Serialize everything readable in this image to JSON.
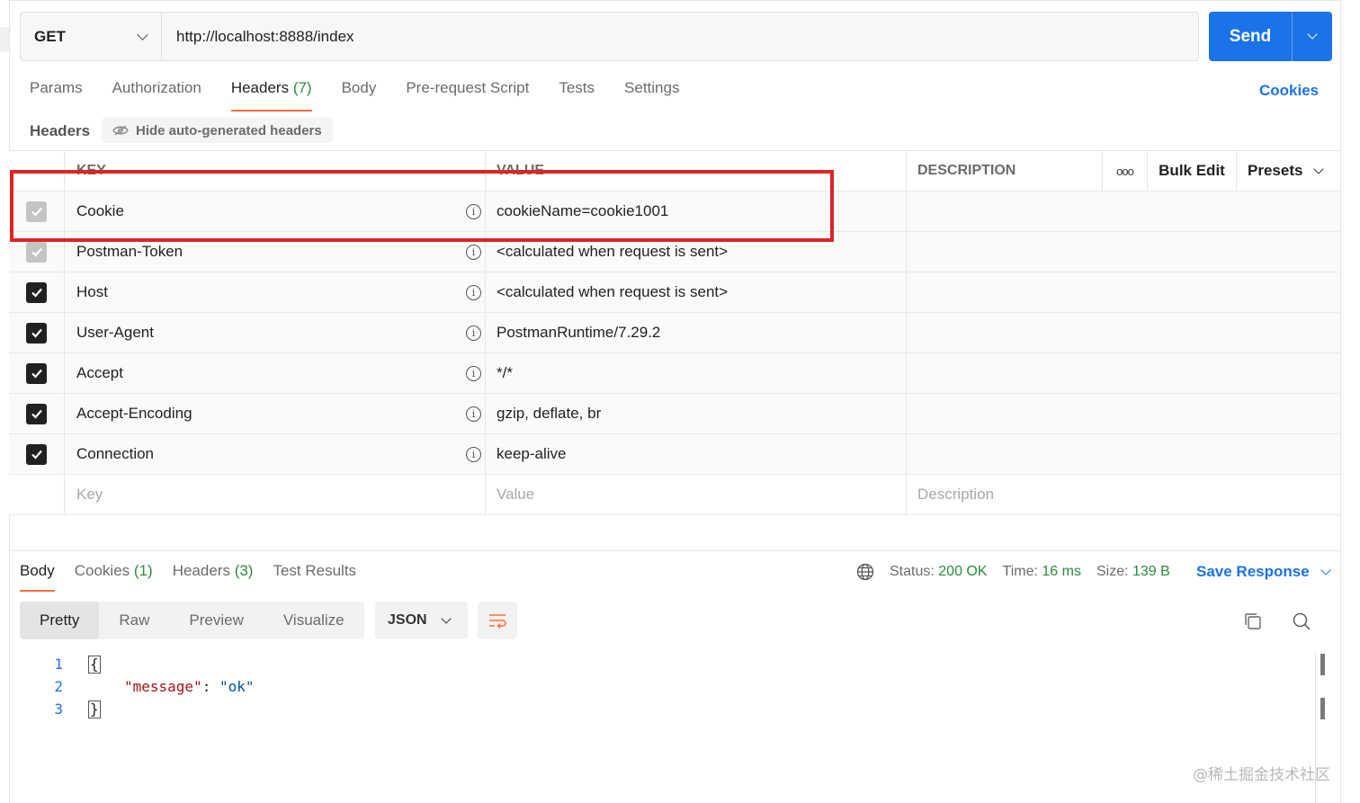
{
  "request": {
    "method": "GET",
    "url": "http://localhost:8888/index",
    "send_label": "Send"
  },
  "req_tabs": [
    {
      "label": "Params",
      "count": ""
    },
    {
      "label": "Authorization",
      "count": ""
    },
    {
      "label": "Headers",
      "count": "(7)"
    },
    {
      "label": "Body",
      "count": ""
    },
    {
      "label": "Pre-request Script",
      "count": ""
    },
    {
      "label": "Tests",
      "count": ""
    },
    {
      "label": "Settings",
      "count": ""
    }
  ],
  "cookies_link": "Cookies",
  "headers_section": {
    "title": "Headers",
    "hide_auto_label": "Hide auto-generated headers"
  },
  "table": {
    "columns": {
      "key": "KEY",
      "value": "VALUE",
      "description": "DESCRIPTION"
    },
    "bulk_edit": "Bulk Edit",
    "presets": "Presets",
    "more": "ooo",
    "rows": [
      {
        "key": "Cookie",
        "value": "cookieName=cookie1001",
        "checked": "dim"
      },
      {
        "key": "Postman-Token",
        "value": "<calculated when request is sent>",
        "checked": "dim"
      },
      {
        "key": "Host",
        "value": "<calculated when request is sent>",
        "checked": "on"
      },
      {
        "key": "User-Agent",
        "value": "PostmanRuntime/7.29.2",
        "checked": "on"
      },
      {
        "key": "Accept",
        "value": "*/*",
        "checked": "on"
      },
      {
        "key": "Accept-Encoding",
        "value": "gzip, deflate, br",
        "checked": "on"
      },
      {
        "key": "Connection",
        "value": "keep-alive",
        "checked": "on"
      }
    ],
    "placeholders": {
      "key": "Key",
      "value": "Value",
      "description": "Description"
    }
  },
  "response": {
    "tabs": [
      {
        "label": "Body",
        "count": ""
      },
      {
        "label": "Cookies",
        "count": "(1)"
      },
      {
        "label": "Headers",
        "count": "(3)"
      },
      {
        "label": "Test Results",
        "count": ""
      }
    ],
    "status_label": "Status:",
    "status_value": "200 OK",
    "time_label": "Time:",
    "time_value": "16 ms",
    "size_label": "Size:",
    "size_value": "139 B",
    "save_label": "Save Response",
    "views": [
      "Pretty",
      "Raw",
      "Preview",
      "Visualize"
    ],
    "format": "JSON",
    "code": {
      "line_numbers": [
        "1",
        "2",
        "3"
      ],
      "open_brace": "{",
      "key": "\"message\"",
      "colon": ": ",
      "value": "\"ok\"",
      "close_brace": "}"
    }
  },
  "watermark": "@稀土掘金技术社区",
  "colors": {
    "accent_blue": "#1a73e8",
    "active_tab_underline": "#ff6c37",
    "highlight_box": "#e02323",
    "success_green": "#2a8a3e"
  }
}
